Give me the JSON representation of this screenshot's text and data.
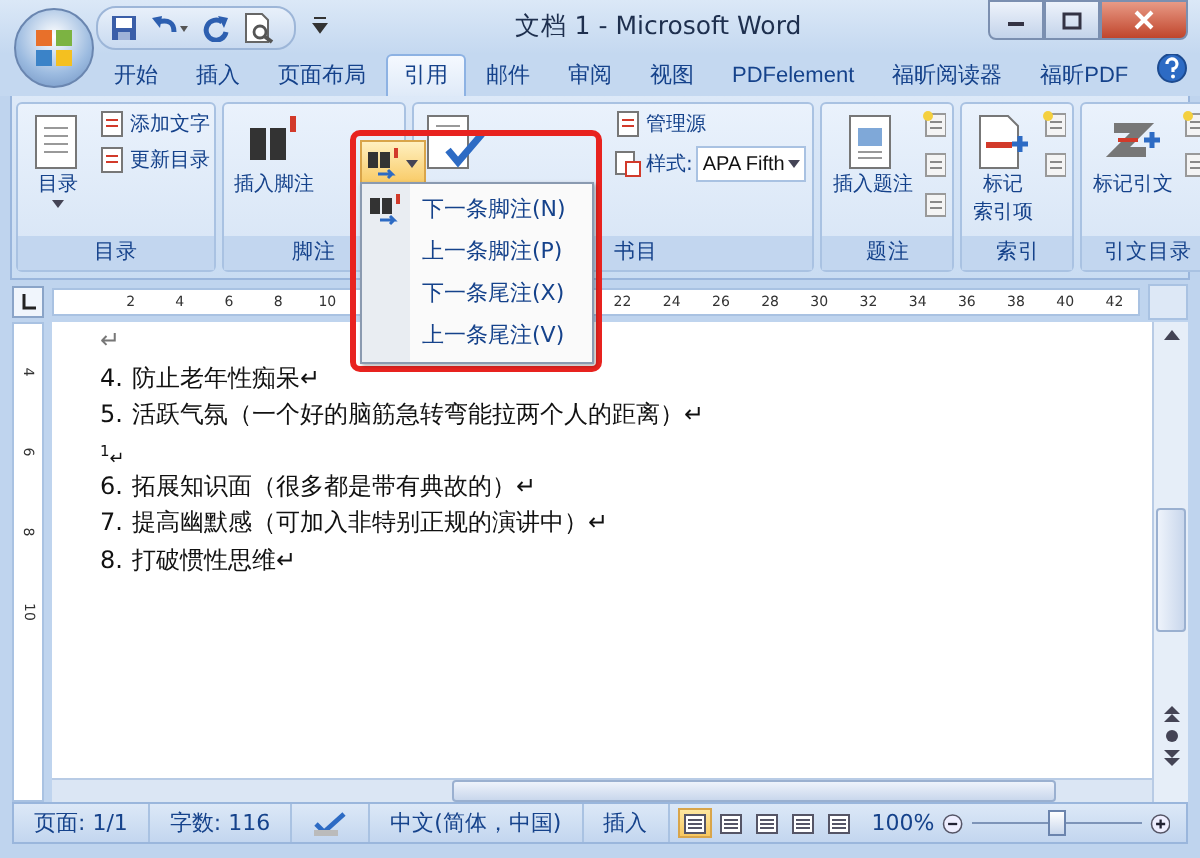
{
  "window": {
    "title": "文档 1 - Microsoft Word"
  },
  "tabs": [
    {
      "label": "开始",
      "selected": false
    },
    {
      "label": "插入",
      "selected": false
    },
    {
      "label": "页面布局",
      "selected": false
    },
    {
      "label": "引用",
      "selected": true
    },
    {
      "label": "邮件",
      "selected": false
    },
    {
      "label": "审阅",
      "selected": false
    },
    {
      "label": "视图",
      "selected": false
    },
    {
      "label": "PDFelement",
      "selected": false
    },
    {
      "label": "福昕阅读器",
      "selected": false
    },
    {
      "label": "福昕PDF",
      "selected": false
    }
  ],
  "ribbon_groups": [
    {
      "label": "目录",
      "buttons": [
        {
          "kind": "large",
          "label": "目录"
        },
        {
          "kind": "small",
          "label": "添加文字"
        },
        {
          "kind": "small",
          "label": "更新目录"
        }
      ]
    },
    {
      "label": "脚注",
      "buttons": [
        {
          "kind": "large",
          "label": "插入脚注"
        }
      ]
    },
    {
      "label": "书目",
      "buttons": [
        {
          "kind": "small",
          "label": "管理源"
        },
        {
          "kind": "field",
          "label": "样式:",
          "value": "APA Fifth"
        }
      ]
    },
    {
      "label": "题注",
      "buttons": [
        {
          "kind": "large",
          "label": "插入题注"
        }
      ]
    },
    {
      "label": "索引",
      "buttons": [
        {
          "kind": "large",
          "lines": [
            "标记",
            "索引项"
          ]
        }
      ]
    },
    {
      "label": "引文目录",
      "buttons": [
        {
          "kind": "large",
          "label": "标记引文"
        }
      ]
    }
  ],
  "dropdown_menu": {
    "items": [
      {
        "label": "下一条脚注(N)",
        "selected": false
      },
      {
        "label": "上一条脚注(P)",
        "selected": false
      },
      {
        "label": "下一条尾注(X)",
        "selected": false
      },
      {
        "label": "上一条尾注(V)",
        "selected": false
      }
    ]
  },
  "ruler": {
    "ticks": [
      "2",
      "4",
      "6",
      "8",
      "10",
      "22",
      "24",
      "26",
      "28",
      "30",
      "32",
      "34",
      "36",
      "38",
      "40",
      "42"
    ],
    "vertical_ticks": [
      "4",
      "6",
      "8",
      "10"
    ]
  },
  "document": {
    "paragraphs": [
      {
        "kind": "mark",
        "text": "↵"
      },
      {
        "kind": "item",
        "number": "4.",
        "text": "防止老年性痴呆↵"
      },
      {
        "kind": "item",
        "number": "5.",
        "text": "活跃气氛（一个好的脑筋急转弯能拉两个人的距离）↵"
      },
      {
        "kind": "note",
        "text": "$^{1}$↵"
      },
      {
        "kind": "item",
        "number": "6.",
        "text": "拓展知识面（很多都是带有典故的）↵"
      },
      {
        "kind": "item",
        "number": "7.",
        "text": "提高幽默感（可加入非特别正规的演讲中）↵"
      },
      {
        "kind": "item",
        "number": "8.",
        "text": "打破惯性思维↵"
      }
    ]
  },
  "status_bar": {
    "page": "页面: 1/1",
    "words": "字数: 116",
    "language": "中文(简体，中国)",
    "mode": "插入",
    "views": [
      {
        "selected": true
      },
      {
        "selected": false
      },
      {
        "selected": false
      },
      {
        "selected": false
      },
      {
        "selected": false
      }
    ],
    "zoom": "100%",
    "zoom_slider": {
      "level": 0.5
    }
  }
}
